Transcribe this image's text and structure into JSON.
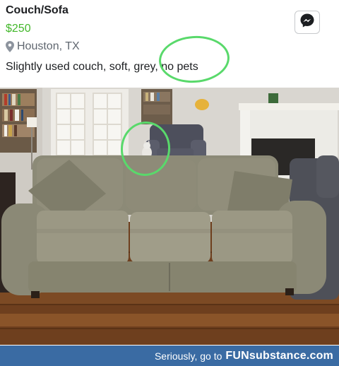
{
  "listing": {
    "title": "Couch/Sofa",
    "price": "$250",
    "location": "Houston, TX",
    "description": "Slightly used couch, soft, grey, no pets"
  },
  "icons": {
    "location": "location-pin-icon",
    "message": "messenger-icon"
  },
  "footer": {
    "tagline": "Seriously, go to",
    "brand": "FUNsubstance.com"
  },
  "colors": {
    "price": "#42b72a",
    "annotation_circle": "#59d96b",
    "footer_bg": "#3a6ba3"
  }
}
